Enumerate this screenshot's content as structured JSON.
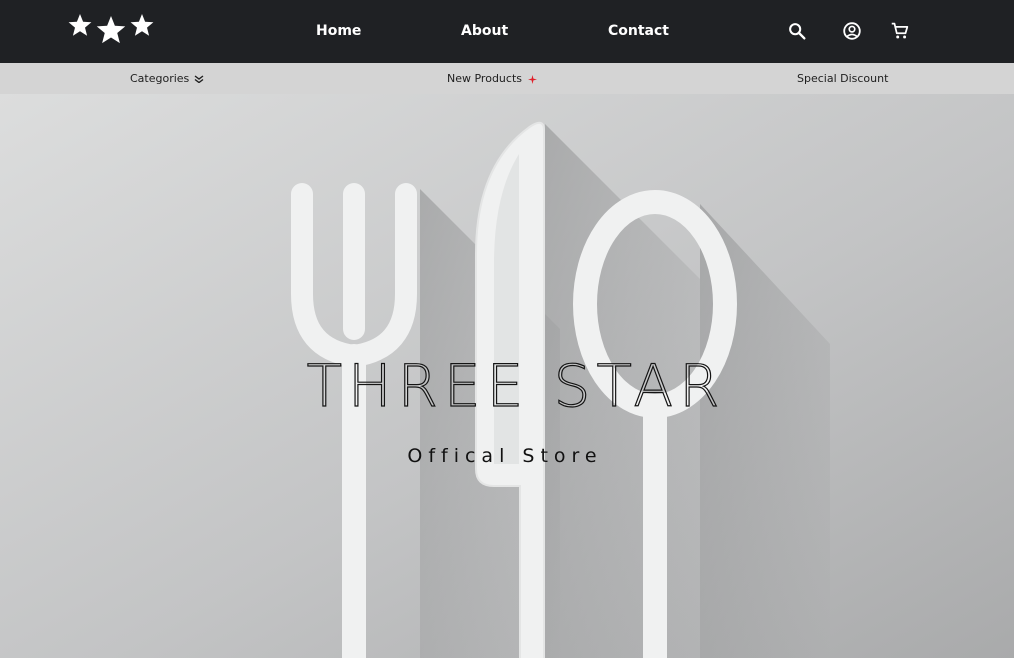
{
  "header": {
    "logo_icon": "three-stars-logo",
    "nav": [
      {
        "label": "Home"
      },
      {
        "label": "About"
      },
      {
        "label": "Contact"
      }
    ],
    "tools": {
      "search_icon": "search-icon",
      "account_icon": "account-circle-icon",
      "cart_icon": "cart-icon"
    }
  },
  "subnav": {
    "categories": {
      "label": "Categories",
      "icon": "double-chevron-down-icon"
    },
    "new_products": {
      "label": "New Products",
      "icon": "sparkle-icon",
      "icon_color": "#e0202a"
    },
    "special_discount": {
      "label": "Special Discount"
    }
  },
  "hero": {
    "brand_title": "THREE STAR",
    "tagline": "Offical Store"
  },
  "colors": {
    "header_bg": "#1f2124",
    "subnav_bg": "#d4d4d4",
    "hero_bg": "#bfc0c1",
    "cutlery": "#f0f1f1"
  }
}
